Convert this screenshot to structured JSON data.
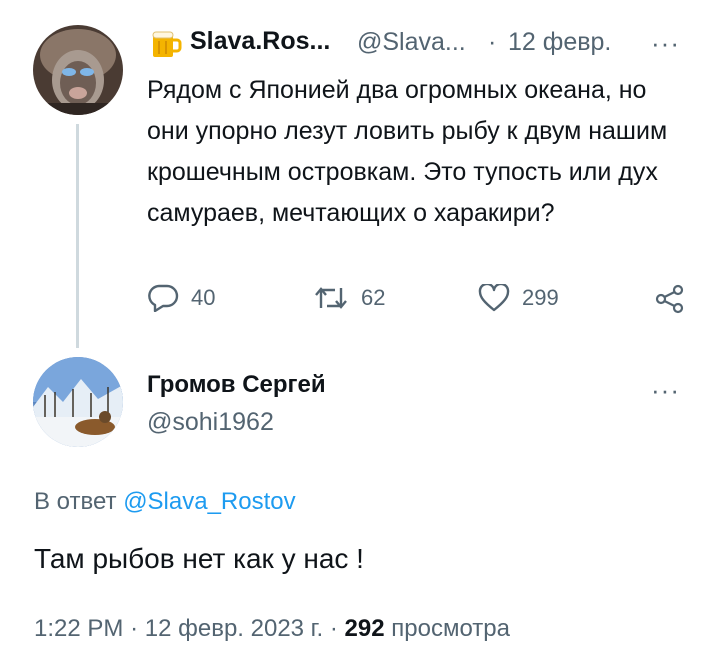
{
  "tweet": {
    "author_name": "Slava.Ros...",
    "author_handle": "@Slava...",
    "separator": "·",
    "date": "12 февр.",
    "text": "Рядом с Японией два огромных океана, но они упорно лезут ловить рыбу к двум нашим крошечным островкам.  Это тупость или дух самураев, мечтающих о харакири?",
    "replies": "40",
    "retweets": "62",
    "likes": "299",
    "more_glyph": "···"
  },
  "reply": {
    "author_name": "Громов Сергей",
    "author_handle": "@sohi1962",
    "reply_prefix": "В ответ",
    "reply_to_handle": "@Slava_Rostov",
    "text": "Там рыбов нет как у нас !",
    "time": "1:22 PM",
    "separator": "·",
    "date": "12 февр. 2023 г.",
    "views_count": "292",
    "views_label": "просмотра",
    "more_glyph": "···"
  },
  "colors": {
    "text": "#0f1419",
    "secondary": "#536471",
    "link": "#1d9bf0",
    "thread_line": "#cfd9de"
  },
  "icons": [
    "beer-mug-icon",
    "reply-icon",
    "retweet-icon",
    "like-icon",
    "share-icon",
    "more-icon"
  ]
}
